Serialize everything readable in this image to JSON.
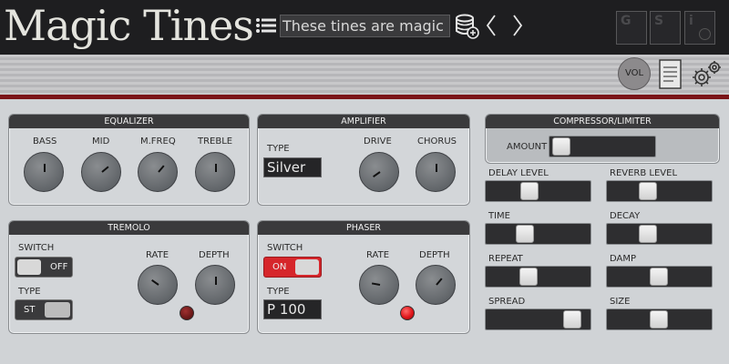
{
  "app": {
    "title": "Magic Tines"
  },
  "preset": {
    "name": "These tines are magic"
  },
  "header_buttons": {
    "g": "G",
    "s": "S",
    "i": "i"
  },
  "toolbar": {
    "vol": "VOL"
  },
  "equalizer": {
    "title": "EQUALIZER",
    "knobs": [
      {
        "label": "BASS"
      },
      {
        "label": "MID"
      },
      {
        "label": "M.FREQ"
      },
      {
        "label": "TREBLE"
      }
    ]
  },
  "amplifier": {
    "title": "AMPLIFIER",
    "type_label": "TYPE",
    "type_value": "Silver",
    "drive_label": "DRIVE",
    "chorus_label": "CHORUS"
  },
  "tremolo": {
    "title": "TREMOLO",
    "switch_label": "SWITCH",
    "switch_state": "OFF",
    "type_label": "TYPE",
    "type_value": "ST",
    "rate_label": "RATE",
    "depth_label": "DEPTH"
  },
  "phaser": {
    "title": "PHASER",
    "switch_label": "SWITCH",
    "switch_state": "ON",
    "type_label": "TYPE",
    "type_value": "P 100",
    "rate_label": "RATE",
    "depth_label": "DEPTH"
  },
  "compressor": {
    "title": "COMPRESSOR/LIMITER",
    "amount_label": "AMOUNT",
    "amount": 0.02
  },
  "delay_reverb": {
    "delay_level": {
      "label": "DELAY LEVEL",
      "value": 0.4
    },
    "reverb_level": {
      "label": "REVERB LEVEL",
      "value": 0.37
    },
    "time": {
      "label": "TIME",
      "value": 0.34
    },
    "decay": {
      "label": "DECAY",
      "value": 0.37
    },
    "repeat": {
      "label": "REPEAT",
      "value": 0.39
    },
    "damp": {
      "label": "DAMP",
      "value": 0.49
    },
    "spread": {
      "label": "SPREAD",
      "value": 0.9
    },
    "size": {
      "label": "SIZE",
      "value": 0.49
    }
  },
  "colors": {
    "accent_red": "#d6262b",
    "panel_header": "#3a3a3c",
    "led_red": "#e0161b"
  }
}
